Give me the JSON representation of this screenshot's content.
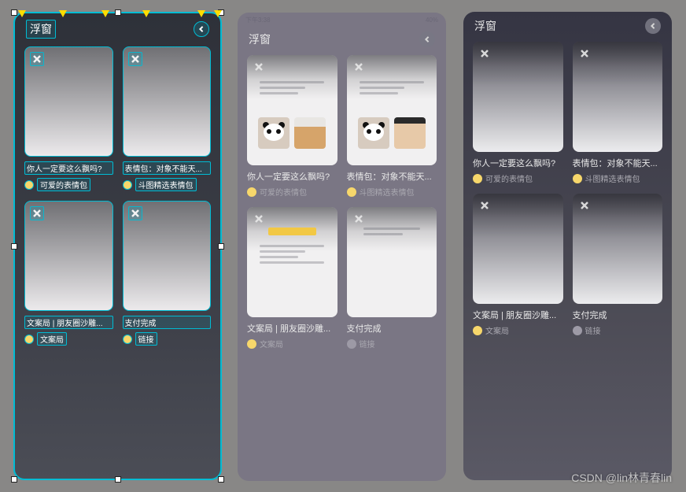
{
  "watermark": "CSDN @lin林青春lin",
  "panels": {
    "spec": {
      "header_title": "浮窗"
    },
    "mid": {
      "header_title": "浮窗",
      "status_left": "下午3:38",
      "status_right": "40%"
    },
    "right": {
      "header_title": "浮窗"
    }
  },
  "cards": [
    {
      "title": "你人一定要这么飘吗?",
      "subtitle": "可爱的表情包",
      "icon": "yellow"
    },
    {
      "title": "表情包：对象不能天...",
      "subtitle": "斗图精选表情包",
      "icon": "yellow"
    },
    {
      "title": "文案局 | 朋友圈沙雕...",
      "subtitle": "文案局",
      "icon": "yellow"
    },
    {
      "title": "支付完成",
      "subtitle": "链接",
      "icon": "grey"
    }
  ]
}
